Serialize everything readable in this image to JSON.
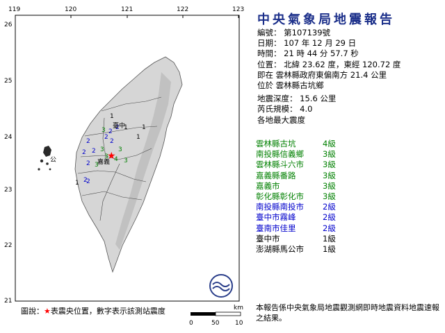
{
  "map": {
    "lon_ticks": [
      "119",
      "120",
      "121",
      "122",
      "123"
    ],
    "lat_ticks": [
      "26",
      "25",
      "24",
      "23",
      "22",
      "21"
    ],
    "epicenter_label": "",
    "place_label_penghu": "澎湖",
    "place_label_penghu2": "公",
    "place_label_taichung": "臺中",
    "place_label_chiayi": "嘉義",
    "station_numbers": [
      "1",
      "2",
      "2",
      "3",
      "2",
      "2",
      "2",
      "2",
      "3",
      "3",
      "3",
      "4",
      "3",
      "3",
      "2",
      "2",
      "2",
      "1",
      "1",
      "2",
      "1",
      "1"
    ],
    "colors": {
      "land": "#d9d9d9",
      "sea": "#ffffff",
      "epicenter": "#ff0000",
      "grid": "#000000",
      "county_line": "#444444"
    }
  },
  "legend": {
    "prefix": "圖說：",
    "star": "★",
    "text": "表震央位置，數字表示該測站震度"
  },
  "scale": {
    "unit": "km",
    "ticks": [
      "0",
      "50",
      "100"
    ]
  },
  "report": {
    "title": "中央氣象局地震報告",
    "number": "編號： 第107139號",
    "date": "日期： 107 年 12 月 29 日",
    "time": "時間： 21 時 44 分 57.7 秒",
    "position": "位置： 北緯 23.62 度，東經 120.72 度",
    "position_desc": "即在 雲林縣政府東偏南方 21.4 公里",
    "located": "位於 雲林縣古坑鄉",
    "depth": "地震深度： 15.6 公里",
    "magnitude": "芮氏規模： 4.0",
    "max_intensity_header": "各地最大震度",
    "footer": "本報告係中央氣象局地震觀測網即時地震資料地震速報之結果。"
  },
  "intensities": [
    {
      "location": "雲林縣古坑",
      "level": "4級",
      "color": "#008000"
    },
    {
      "location": "南投縣信義鄉",
      "level": "3級",
      "color": "#008000"
    },
    {
      "location": "雲林縣斗六市",
      "level": "3級",
      "color": "#008000"
    },
    {
      "location": "嘉義縣番路",
      "level": "3級",
      "color": "#008000"
    },
    {
      "location": "嘉義市",
      "level": "3級",
      "color": "#008000"
    },
    {
      "location": "彰化縣彰化市",
      "level": "3級",
      "color": "#008000"
    },
    {
      "location": "南投縣南投市",
      "level": "2級",
      "color": "#0000cc"
    },
    {
      "location": "臺中市霧峰",
      "level": "2級",
      "color": "#0000cc"
    },
    {
      "location": "臺南市佳里",
      "level": "2級",
      "color": "#0000cc"
    },
    {
      "location": "臺中市",
      "level": "1級",
      "color": "#000000"
    },
    {
      "location": "澎湖縣馬公市",
      "level": "1級",
      "color": "#000000"
    }
  ]
}
